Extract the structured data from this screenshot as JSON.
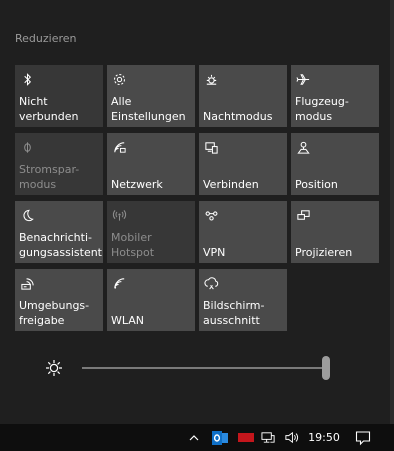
{
  "header": {
    "collapse_label": "Reduzieren"
  },
  "tiles": [
    {
      "label": "Nicht\nverbunden",
      "icon": "bluetooth-icon",
      "state": "on"
    },
    {
      "label": "Alle\nEinstellungen",
      "icon": "gear-icon",
      "state": "on"
    },
    {
      "label": "Nachtmodus",
      "icon": "night-light-icon",
      "state": "on"
    },
    {
      "label": "Flugzeug-\nmodus",
      "icon": "airplane-icon",
      "state": "on"
    },
    {
      "label": "Stromspar-\nmodus",
      "icon": "battery-saver-icon",
      "state": "disabled"
    },
    {
      "label": "Netzwerk",
      "icon": "network-icon",
      "state": "on"
    },
    {
      "label": "Verbinden",
      "icon": "connect-icon",
      "state": "on"
    },
    {
      "label": "Position",
      "icon": "location-icon",
      "state": "on"
    },
    {
      "label": "Benachrichti-\ngungsassistent",
      "icon": "moon-icon",
      "state": "on"
    },
    {
      "label": "Mobiler\nHotspot",
      "icon": "hotspot-icon",
      "state": "disabled"
    },
    {
      "label": "VPN",
      "icon": "vpn-icon",
      "state": "on"
    },
    {
      "label": "Projizieren",
      "icon": "project-icon",
      "state": "on"
    },
    {
      "label": "Umgebungs-\nfreigabe",
      "icon": "nearby-share-icon",
      "state": "on"
    },
    {
      "label": "WLAN",
      "icon": "wifi-icon",
      "state": "on"
    },
    {
      "label": "Bildschirm-\nausschnitt",
      "icon": "snip-icon",
      "state": "on"
    }
  ],
  "brightness": {
    "icon": "sun-icon",
    "level_percent": 100
  },
  "taskbar": {
    "clock": "19:50",
    "tray_icons": [
      "chevron-up-icon",
      "outlook-icon",
      "red-app-icon",
      "network-icon",
      "speaker-icon"
    ],
    "action_center_icon": "notification-icon"
  },
  "colors": {
    "background": "#1f1f1f",
    "tile_active": "#4a4a4a",
    "tile_inactive": "#373737",
    "taskbar": "#0e0e0e",
    "outlook_blue": "#0f6fc6",
    "red_app": "#c4161c"
  }
}
